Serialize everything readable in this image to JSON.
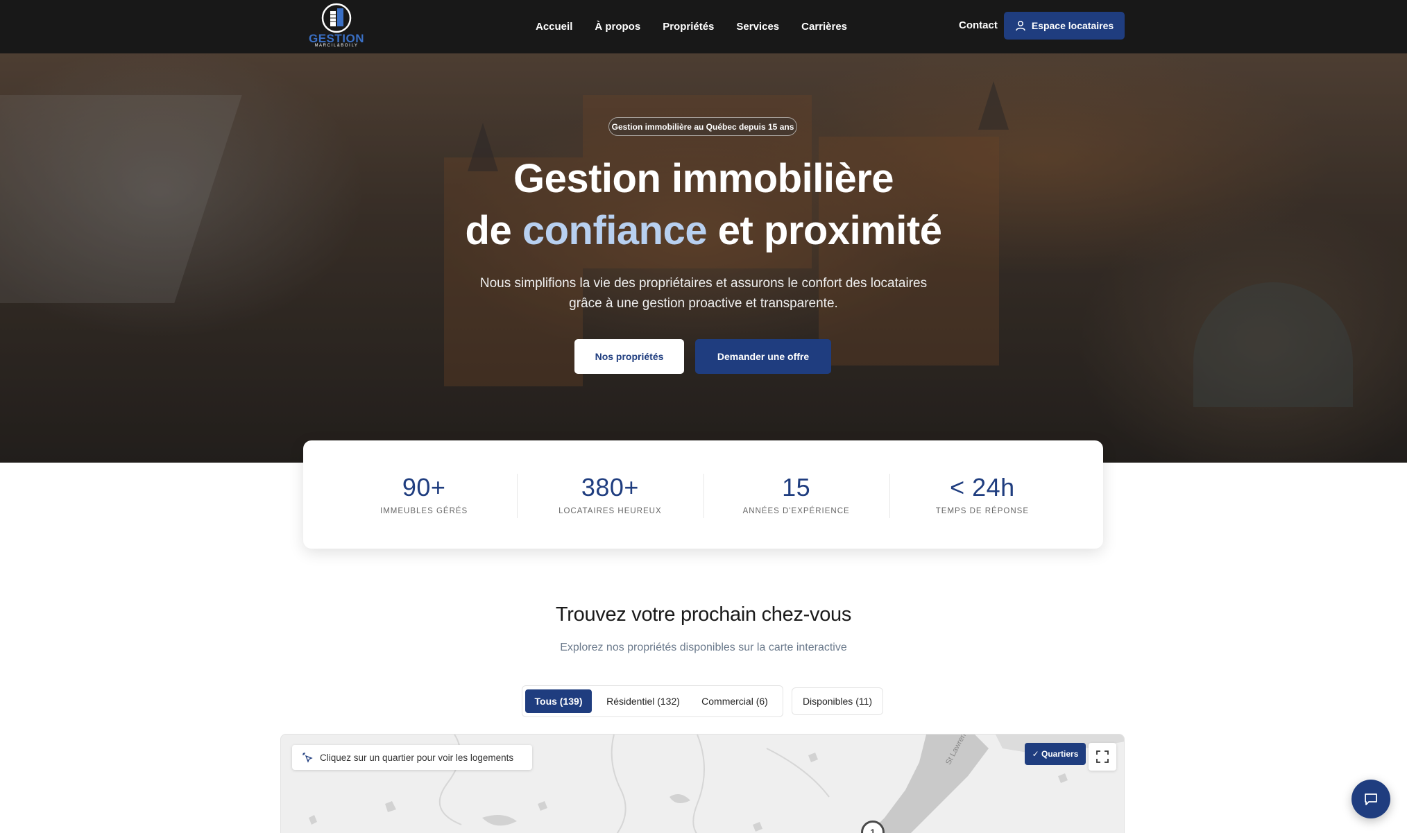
{
  "brand": {
    "logo_text": "GESTION",
    "logo_subtext": "MARCIL&BOILY",
    "accent_color": "#1f3d7f",
    "highlight_color": "#b8d0f0"
  },
  "nav": {
    "links": [
      "Accueil",
      "À propos",
      "Propriétés",
      "Services",
      "Carrières"
    ],
    "contact": "Contact",
    "cta_label": "Espace locataires",
    "cta_icon": "user-icon"
  },
  "hero": {
    "badge": "Gestion immobilière au Québec depuis 15 ans",
    "title_line1": "Gestion immobilière",
    "title_line2_prefix": "de ",
    "title_line2_accent": "confiance",
    "title_line2_suffix": " et proximité",
    "subtitle_line1": "Nous simplifions la vie des propriétaires et assurons le confort des locataires",
    "subtitle_line2": "grâce à une gestion proactive et transparente.",
    "primary_button": "Nos propriétés",
    "secondary_button": "Demander une offre"
  },
  "stats": [
    {
      "value": "90+",
      "label": "IMMEUBLES GÉRÉS"
    },
    {
      "value": "380+",
      "label": "LOCATAIRES HEUREUX"
    },
    {
      "value": "15",
      "label": "ANNÉES D'EXPÉRIENCE"
    },
    {
      "value": "< 24h",
      "label": "TEMPS DE RÉPONSE"
    }
  ],
  "listings": {
    "title": "Trouvez votre prochain chez-vous",
    "subtitle": "Explorez nos propriétés disponibles sur la carte interactive",
    "filters": [
      {
        "label": "Tous (139)",
        "active": true
      },
      {
        "label": "Résidentiel (132)",
        "active": false
      },
      {
        "label": "Commercial (6)",
        "active": false
      }
    ],
    "availability_filter": "Disponibles (11)"
  },
  "map": {
    "hint": "Cliquez sur un quartier pour voir les logements",
    "hint_icon": "pointer-click-icon",
    "toggle_label": "✓ Quartiers",
    "fullscreen_icon": "fullscreen-icon",
    "cluster_count": "1",
    "river_label": "St Lawrence Riv"
  },
  "chat": {
    "icon": "chat-bubble-icon"
  }
}
